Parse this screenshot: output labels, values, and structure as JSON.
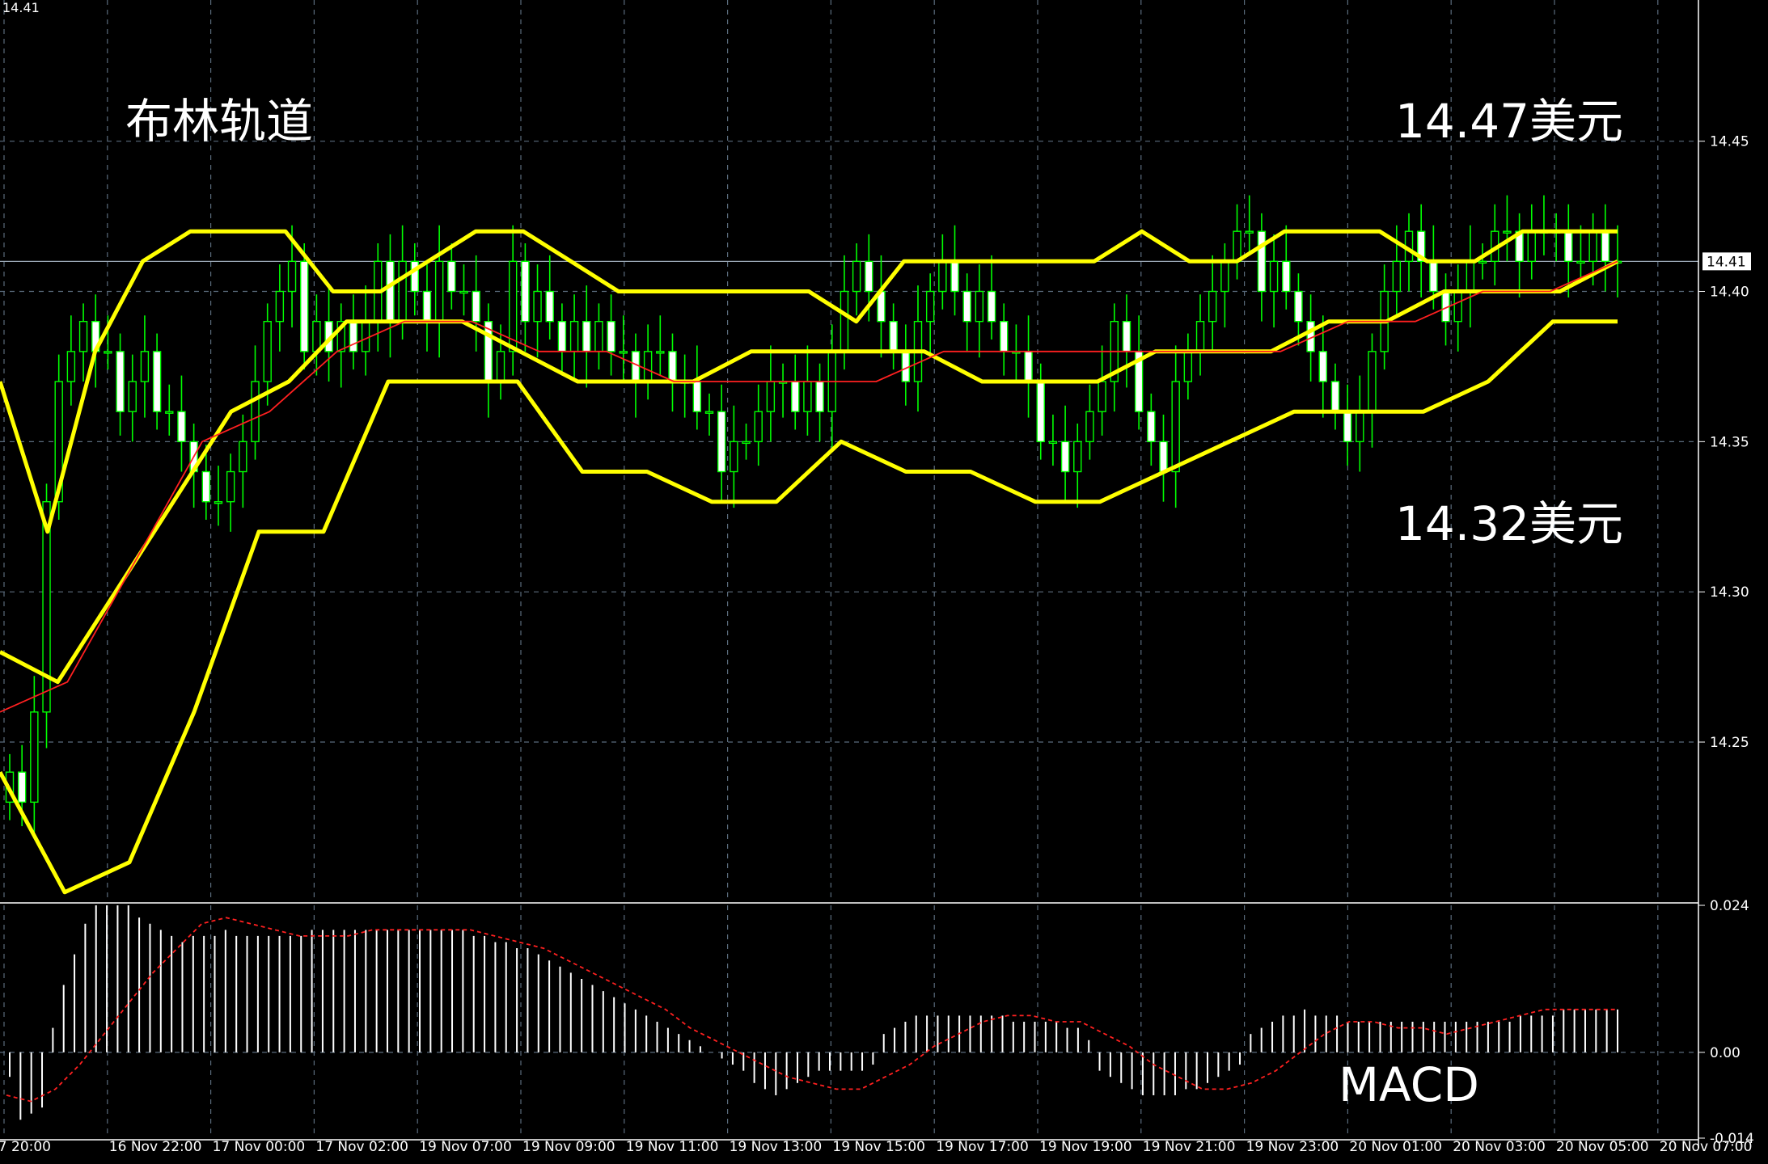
{
  "chart_data": [
    {
      "type": "candlestick",
      "title": "",
      "ylim": [
        14.197,
        14.497
      ],
      "yticks": [
        "14.45",
        "14.40",
        "14.35",
        "14.30",
        "14.25"
      ],
      "top_left_price": "14.41",
      "current_price_label": "14.41",
      "current_price": 14.41,
      "annotations": {
        "title": "布林轨道",
        "upper_price": "14.47美元",
        "lower_price": "14.32美元"
      },
      "x_labels": [
        "7 20:00",
        "16 Nov 22:00",
        "17 Nov 00:00",
        "17 Nov 02:00",
        "19 Nov 07:00",
        "19 Nov 09:00",
        "19 Nov 11:00",
        "19 Nov 13:00",
        "19 Nov 15:00",
        "19 Nov 17:00",
        "19 Nov 19:00",
        "19 Nov 21:00",
        "19 Nov 23:00",
        "20 Nov 01:00",
        "20 Nov 03:00",
        "20 Nov 05:00",
        "20 Nov 07:00"
      ],
      "candles_per_label": 16,
      "candles_close": [
        14.24,
        14.23,
        14.26,
        14.33,
        14.37,
        14.38,
        14.39,
        14.38,
        14.38,
        14.36,
        14.37,
        14.38,
        14.36,
        14.36,
        14.35,
        14.34,
        14.33,
        14.33,
        14.34,
        14.35,
        14.37,
        14.39,
        14.4,
        14.41,
        14.38,
        14.39,
        14.38,
        14.39,
        14.38,
        14.39,
        14.41,
        14.39,
        14.41,
        14.4,
        14.39,
        14.41,
        14.4,
        14.4,
        14.39,
        14.37,
        14.38,
        14.41,
        14.39,
        14.4,
        14.39,
        14.38,
        14.39,
        14.38,
        14.39,
        14.38,
        14.38,
        14.37,
        14.38,
        14.38,
        14.37,
        14.37,
        14.36,
        14.36,
        14.34,
        14.35,
        14.35,
        14.36,
        14.37,
        14.37,
        14.36,
        14.37,
        14.36,
        14.38,
        14.4,
        14.41,
        14.4,
        14.39,
        14.38,
        14.37,
        14.39,
        14.4,
        14.41,
        14.4,
        14.39,
        14.4,
        14.39,
        14.38,
        14.38,
        14.37,
        14.35,
        14.35,
        14.34,
        14.35,
        14.36,
        14.37,
        14.39,
        14.38,
        14.36,
        14.35,
        14.34,
        14.37,
        14.38,
        14.39,
        14.4,
        14.41,
        14.42,
        14.42,
        14.4,
        14.41,
        14.4,
        14.39,
        14.38,
        14.37,
        14.36,
        14.35,
        14.36,
        14.38,
        14.4,
        14.41,
        14.42,
        14.41,
        14.4,
        14.39,
        14.4,
        14.41,
        14.41,
        14.42,
        14.42,
        14.41,
        14.42,
        14.42,
        14.42,
        14.41,
        14.41,
        14.42,
        14.41,
        14.41
      ],
      "bollinger": {
        "upper": [
          14.37,
          14.32,
          14.38,
          14.41,
          14.42,
          14.42,
          14.42,
          14.4,
          14.4,
          14.41,
          14.42,
          14.42,
          14.41,
          14.4,
          14.4,
          14.4,
          14.4,
          14.4,
          14.39,
          14.41,
          14.41,
          14.41,
          14.41,
          14.41,
          14.42,
          14.41,
          14.41,
          14.42,
          14.42,
          14.42,
          14.41,
          14.41,
          14.42,
          14.42,
          14.42
        ],
        "middle": [
          14.28,
          14.27,
          14.3,
          14.33,
          14.36,
          14.37,
          14.39,
          14.39,
          14.39,
          14.38,
          14.37,
          14.37,
          14.37,
          14.38,
          14.38,
          14.38,
          14.38,
          14.37,
          14.37,
          14.37,
          14.38,
          14.38,
          14.38,
          14.39,
          14.39,
          14.4,
          14.4,
          14.4,
          14.41
        ],
        "lower": [
          14.24,
          14.2,
          14.21,
          14.26,
          14.32,
          14.32,
          14.37,
          14.37,
          14.37,
          14.34,
          14.34,
          14.33,
          14.33,
          14.35,
          14.34,
          14.34,
          14.33,
          14.33,
          14.34,
          14.35,
          14.36,
          14.36,
          14.36,
          14.37,
          14.39,
          14.39
        ]
      },
      "ma_red": [
        14.26,
        14.27,
        14.31,
        14.35,
        14.36,
        14.38,
        14.39,
        14.39,
        14.38,
        14.38,
        14.37,
        14.37,
        14.37,
        14.37,
        14.38,
        14.38,
        14.38,
        14.38,
        14.38,
        14.38,
        14.39,
        14.39,
        14.4,
        14.4,
        14.41
      ]
    },
    {
      "type": "macd",
      "title": "MACD",
      "ylim": [
        -0.014,
        0.024
      ],
      "yticks": [
        "0.024",
        "0.00",
        "-0.014"
      ],
      "histogram": [
        -0.004,
        -0.011,
        -0.01,
        -0.009,
        0.004,
        0.011,
        0.016,
        0.021,
        0.024,
        0.024,
        0.024,
        0.024,
        0.022,
        0.021,
        0.02,
        0.019,
        0.018,
        0.019,
        0.019,
        0.019,
        0.02,
        0.019,
        0.019,
        0.019,
        0.019,
        0.019,
        0.019,
        0.019,
        0.02,
        0.02,
        0.02,
        0.02,
        0.02,
        0.02,
        0.02,
        0.02,
        0.02,
        0.02,
        0.02,
        0.02,
        0.02,
        0.02,
        0.02,
        0.019,
        0.019,
        0.018,
        0.018,
        0.017,
        0.017,
        0.016,
        0.015,
        0.014,
        0.013,
        0.012,
        0.011,
        0.01,
        0.009,
        0.008,
        0.007,
        0.006,
        0.005,
        0.004,
        0.003,
        0.002,
        0.001,
        0.0,
        -0.001,
        -0.002,
        -0.003,
        -0.005,
        -0.006,
        -0.007,
        -0.006,
        -0.005,
        -0.004,
        -0.003,
        -0.003,
        -0.003,
        -0.003,
        -0.003,
        -0.002,
        0.003,
        0.004,
        0.005,
        0.006,
        0.006,
        0.006,
        0.006,
        0.006,
        0.006,
        0.006,
        0.006,
        0.006,
        0.005,
        0.005,
        0.005,
        0.005,
        0.005,
        0.004,
        0.004,
        0.002,
        -0.003,
        -0.004,
        -0.005,
        -0.006,
        -0.007,
        -0.007,
        -0.007,
        -0.007,
        -0.006,
        -0.006,
        -0.005,
        -0.004,
        -0.003,
        -0.002,
        0.003,
        0.004,
        0.005,
        0.006,
        0.006,
        0.007,
        0.006,
        0.006,
        0.006,
        0.005,
        0.005,
        0.005,
        0.005,
        0.005,
        0.005,
        0.005,
        0.005,
        0.005,
        0.005,
        0.005,
        0.005,
        0.005,
        0.005,
        0.005,
        0.005,
        0.006,
        0.006,
        0.006,
        0.006,
        0.007,
        0.007,
        0.007,
        0.007,
        0.007,
        0.007
      ],
      "signal": [
        -0.007,
        -0.008,
        -0.006,
        -0.002,
        0.003,
        0.008,
        0.013,
        0.017,
        0.021,
        0.022,
        0.021,
        0.02,
        0.019,
        0.019,
        0.019,
        0.02,
        0.02,
        0.02,
        0.02,
        0.02,
        0.019,
        0.018,
        0.017,
        0.015,
        0.013,
        0.011,
        0.009,
        0.007,
        0.004,
        0.002,
        0.0,
        -0.002,
        -0.004,
        -0.005,
        -0.006,
        -0.006,
        -0.004,
        -0.002,
        0.001,
        0.003,
        0.005,
        0.006,
        0.006,
        0.005,
        0.005,
        0.003,
        0.001,
        -0.002,
        -0.004,
        -0.006,
        -0.006,
        -0.005,
        -0.003,
        0.0,
        0.003,
        0.005,
        0.005,
        0.004,
        0.004,
        0.003,
        0.004,
        0.005,
        0.006,
        0.007,
        0.007,
        0.007,
        0.007
      ]
    }
  ]
}
